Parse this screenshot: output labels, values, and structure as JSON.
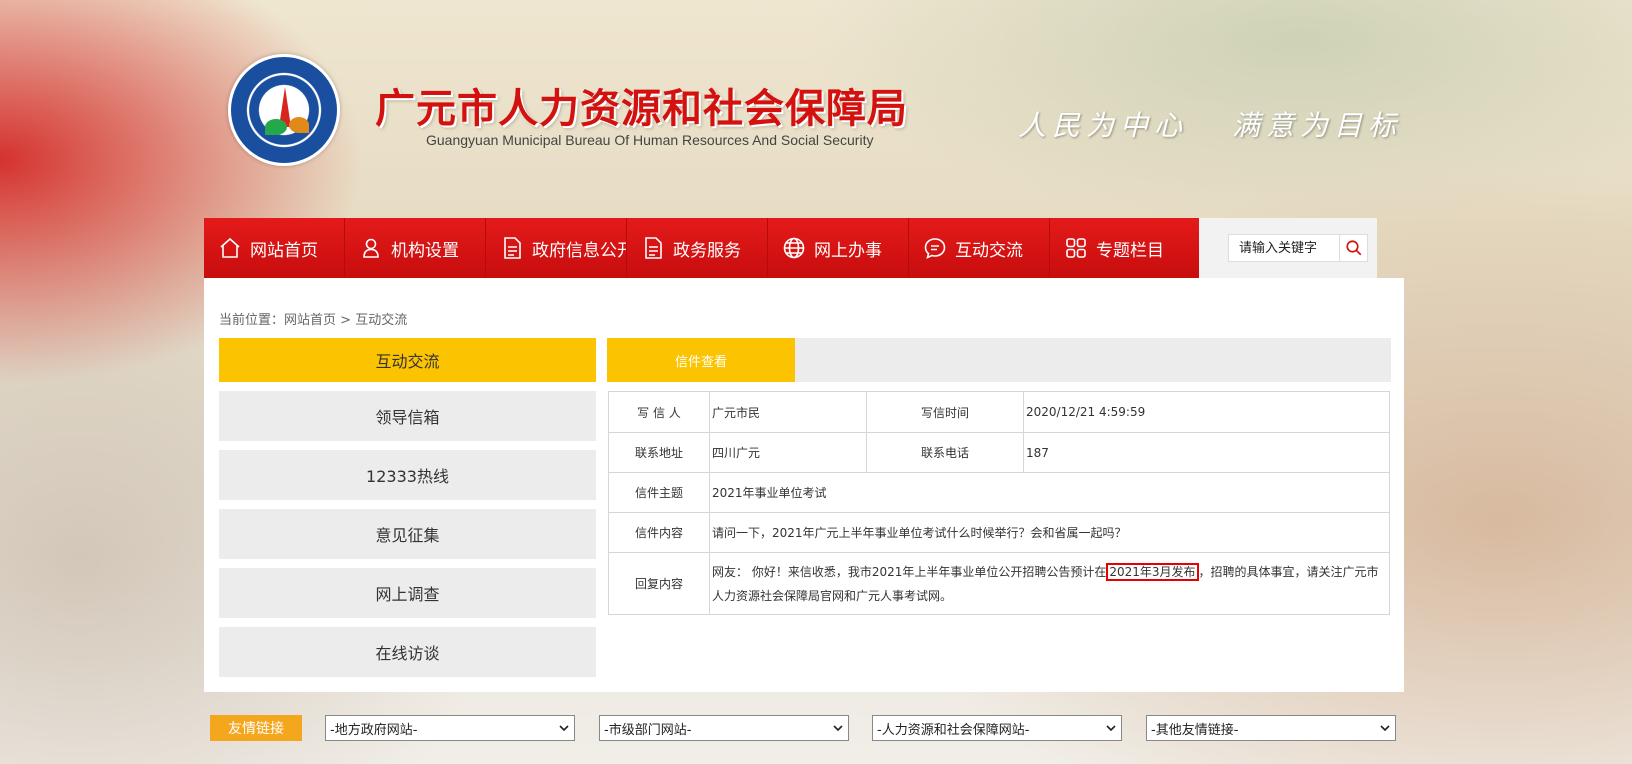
{
  "header": {
    "title": "广元市人力资源和社会保障局",
    "subtitle": "Guangyuan Municipal Bureau Of Human Resources And Social Security",
    "slogan_1": "人民为中心",
    "slogan_2": "满意为目标",
    "logo_icon": "bureau-seal-logo"
  },
  "nav": {
    "items": [
      {
        "label": "网站首页",
        "icon": "home-icon"
      },
      {
        "label": "机构设置",
        "icon": "person-icon"
      },
      {
        "label": "政府信息公开",
        "icon": "document-icon"
      },
      {
        "label": "政务服务",
        "icon": "document-icon"
      },
      {
        "label": "网上办事",
        "icon": "globe-icon"
      },
      {
        "label": "互动交流",
        "icon": "chat-icon"
      },
      {
        "label": "专题栏目",
        "icon": "grid-icon"
      }
    ],
    "search_placeholder": "请输入关键字"
  },
  "breadcrumb": {
    "prefix": "当前位置：",
    "home": "网站首页",
    "sep": ">",
    "current": "互动交流"
  },
  "sidebar": {
    "heading": "互动交流",
    "items": [
      "领导信箱",
      "12333热线",
      "意见征集",
      "网上调查",
      "在线访谈"
    ]
  },
  "tab": {
    "label": "信件查看"
  },
  "letter": {
    "writer_label": "写 信 人",
    "writer": "广元市民",
    "time_label": "写信时间",
    "time": "2020/12/21 4:59:59",
    "address_label": "联系地址",
    "address": "四川广元",
    "phone_label": "联系电话",
    "phone": "187",
    "subject_label": "信件主题",
    "subject": "2021年事业单位考试",
    "content_label": "信件内容",
    "content": "请问一下，2021年广元上半年事业单位考试什么时候举行？会和省属一起吗？",
    "reply_label": "回复内容",
    "reply_before": "网友：  你好！来信收悉，我市2021年上半年事业单位公开招聘公告预计在",
    "reply_highlight": "2021年3月发布",
    "reply_after": "，招聘的具体事宜，请关注广元市人力资源社会保障局官网和广元人事考试网。"
  },
  "footer": {
    "friend_links_label": "友情链接",
    "selects": [
      "-地方政府网站-",
      "-市级部门网站-",
      "-人力资源和社会保障网站-",
      "-其他友情链接-"
    ]
  },
  "colors": {
    "nav_red": "#d3120f",
    "accent_yellow": "#fbc300",
    "friend_orange": "#f4a61d",
    "highlight_red": "#e60000"
  }
}
